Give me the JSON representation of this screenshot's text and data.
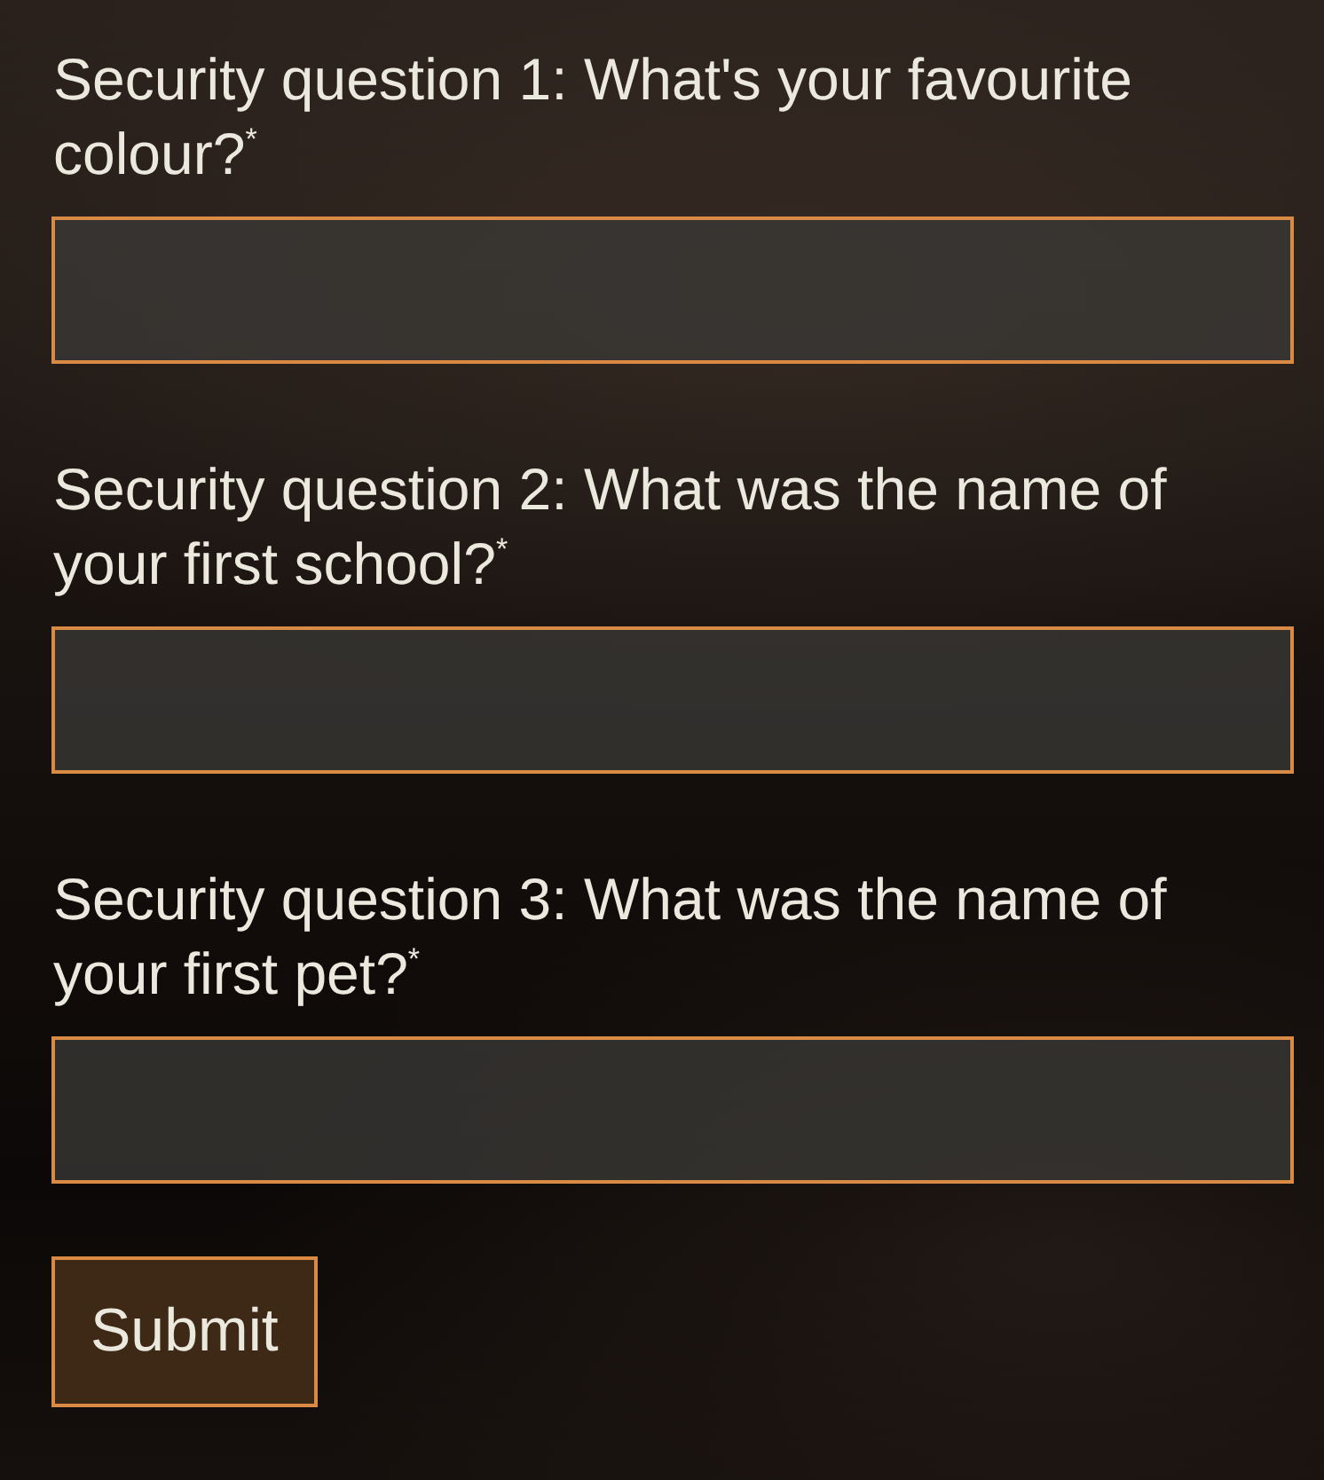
{
  "questions": [
    {
      "label": "Security question 1: What's your favourite colour?$^{*}$"
    },
    {
      "label": "Security question 2: What was the name of your first school?$^{*}$"
    },
    {
      "label": "Security question 3: What was the name of your first pet?$^{*}$"
    }
  ],
  "submit_button": {
    "label": "Submit"
  }
}
